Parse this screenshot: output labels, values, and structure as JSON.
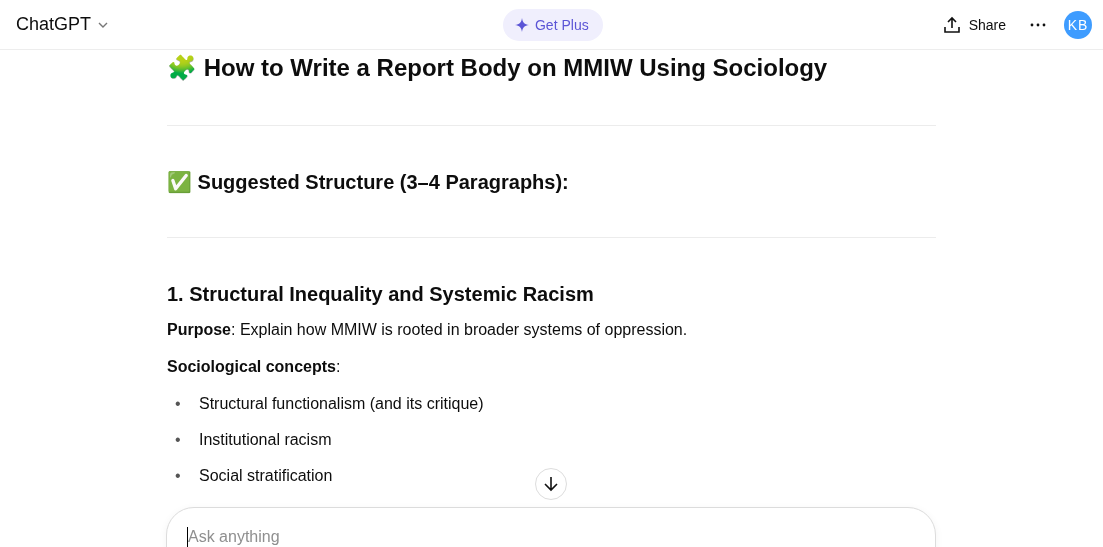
{
  "header": {
    "title": "ChatGPT",
    "upgrade": "Get Plus",
    "share": "Share",
    "avatar": "KB"
  },
  "content": {
    "title": "🧩 How to Write a Report Body on MMIW Using Sociology",
    "section": "✅ Suggested Structure (3–4 Paragraphs):",
    "subsection": "1. Structural Inequality and Systemic Racism",
    "paragraphs": [
      "**Purpose**: Explain how MMIW is rooted in broader systems of oppression.",
      "**Sociological concepts**:"
    ],
    "bullets": [
      {
        "marker": "•",
        "text": "Structural functionalism (and its critique)"
      },
      {
        "marker": "•",
        "text": "Institutional racism"
      },
      {
        "marker": "•",
        "text": "Social stratification"
      }
    ]
  },
  "composer": {
    "placeholder": "Ask anything"
  }
}
